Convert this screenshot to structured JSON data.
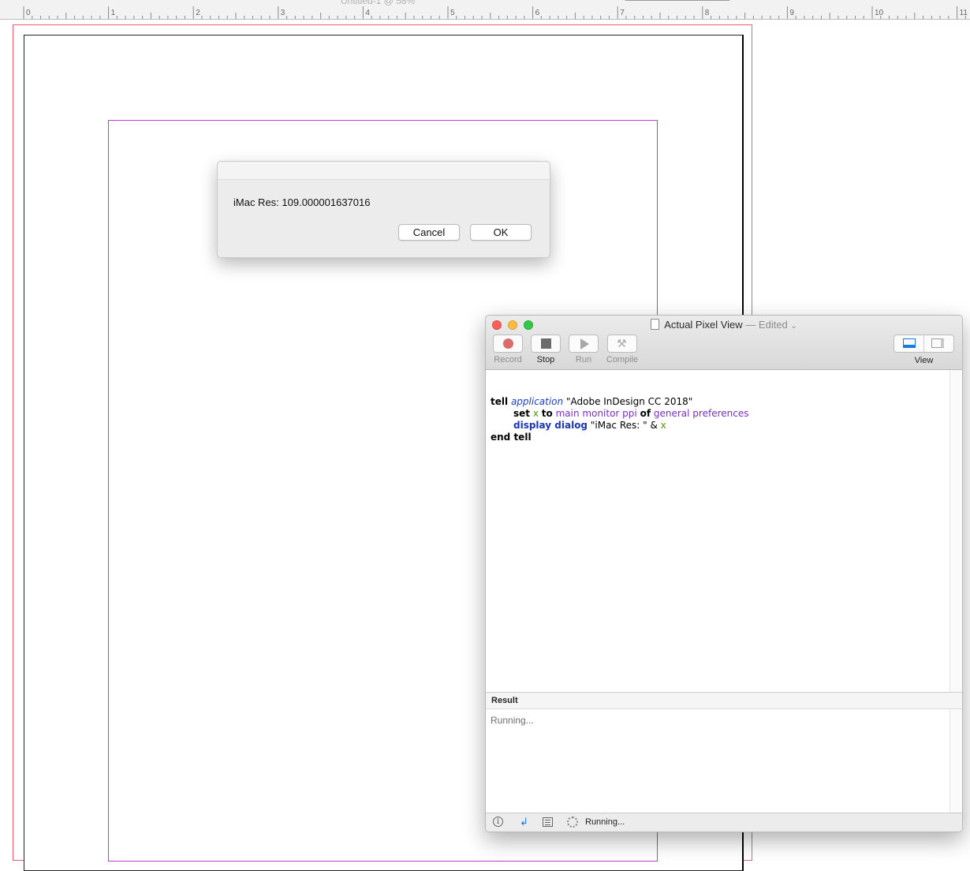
{
  "ruler": {
    "document_title": "Untitled-1 @ 58%",
    "numbers": [
      "0",
      "1",
      "2",
      "3",
      "4",
      "5",
      "6",
      "7",
      "8",
      "9",
      "10",
      "11"
    ]
  },
  "dialog": {
    "message": "iMac Res: 109.000001637016",
    "cancel_label": "Cancel",
    "ok_label": "OK"
  },
  "script_editor": {
    "window_title": "Actual Pixel View",
    "title_separator": "—",
    "title_status": "Edited",
    "toolbar": {
      "record_label": "Record",
      "stop_label": "Stop",
      "run_label": "Run",
      "compile_label": "Compile",
      "view_label": "View"
    },
    "code": {
      "line1": {
        "tell": "tell",
        "application": "application",
        "app_name": "\"Adobe InDesign CC 2018\""
      },
      "line2": {
        "set": "set",
        "var": "x",
        "to": "to",
        "prop1": "main monitor ppi",
        "of": "of",
        "prop2": "general preferences"
      },
      "line3": {
        "cmd": "display dialog",
        "string": "\"iMac Res: \"",
        "amp": "&",
        "var": "x"
      },
      "line4": {
        "end_tell": "end tell"
      }
    },
    "result": {
      "header": "Result",
      "text": "Running..."
    },
    "status": {
      "text": "Running..."
    }
  },
  "colors": {
    "bleed_guide": "#f25c6e",
    "margin_guide": "#c03ad8",
    "applescript_class": "#1a3ed6",
    "applescript_variable": "#4e9b0e",
    "applescript_property": "#7a2fc9",
    "applescript_command": "#1a37b8"
  }
}
